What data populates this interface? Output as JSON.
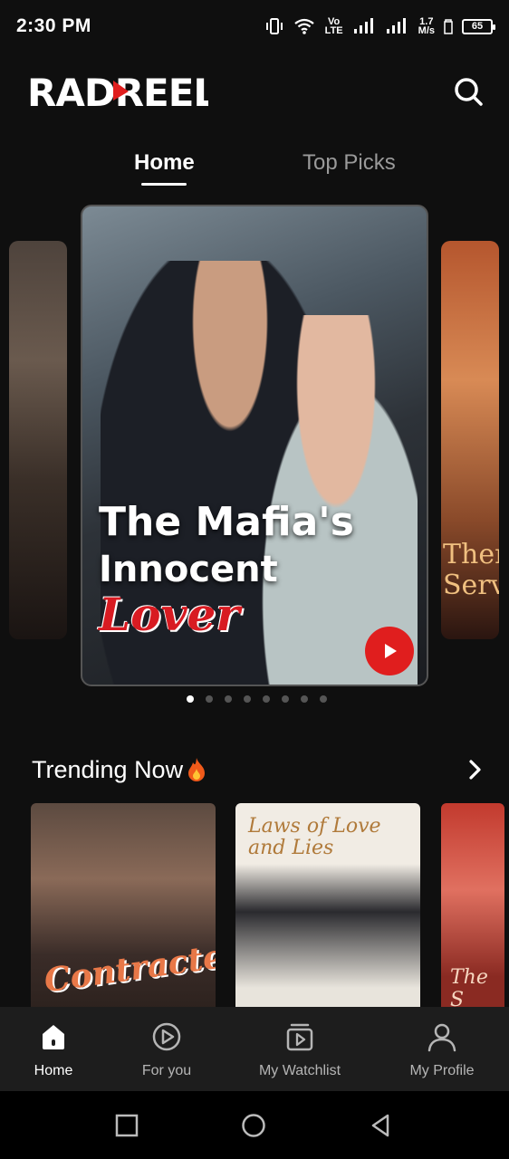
{
  "status_bar": {
    "time": "2:30 PM",
    "network_type": "Vo LTE",
    "speed_value": "1.7",
    "speed_unit": "M/s",
    "battery": "65"
  },
  "header": {
    "logo": "RADREEL",
    "search_icon": "search-icon"
  },
  "tabs": [
    {
      "label": "Home",
      "active": true
    },
    {
      "label": "Top Picks",
      "active": false
    }
  ],
  "carousel": {
    "featured": {
      "title_line1": "The Mafia's",
      "title_line2_a": "Innocent",
      "title_line2_b": "Lover"
    },
    "right_peek_text": "Then\nServ",
    "dots_total": 8,
    "active_dot": 0
  },
  "trending": {
    "title": "Trending Now",
    "cards": [
      {
        "title_text": "Contracted"
      },
      {
        "title_text": "Laws of Love and Lies"
      },
      {
        "title_text": "The S"
      }
    ]
  },
  "bottom_nav": [
    {
      "label": "Home",
      "icon": "home-icon",
      "active": true
    },
    {
      "label": "For you",
      "icon": "play-circle-icon",
      "active": false
    },
    {
      "label": "My Watchlist",
      "icon": "watchlist-icon",
      "active": false
    },
    {
      "label": "My Profile",
      "icon": "profile-icon",
      "active": false
    }
  ],
  "colors": {
    "background": "#0f0f0f",
    "accent_red": "#e01e1e",
    "nav_bg": "#1d1d1d",
    "inactive_text": "#9a9a9a"
  }
}
